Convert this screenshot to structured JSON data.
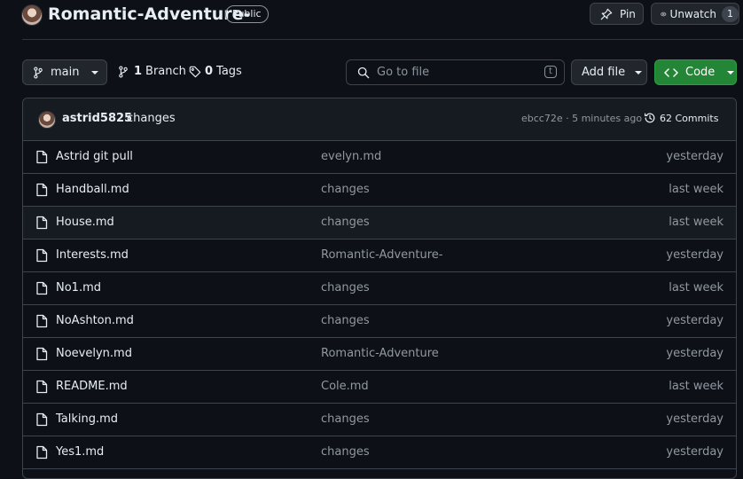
{
  "repo": {
    "name": "Romantic-Adventure-",
    "visibility": "Public"
  },
  "actions": {
    "pin_label": "Pin",
    "unwatch_label": "Unwatch",
    "watch_count": "1"
  },
  "toolbar": {
    "branch": "main",
    "branch_count": "1",
    "branch_label": "Branch",
    "tag_count": "0",
    "tag_label": "Tags",
    "search_placeholder": "Go to file",
    "search_shortcut": "t",
    "add_file_label": "Add file",
    "code_label": "Code"
  },
  "latest_commit": {
    "author": "astrid5825",
    "message": "changes",
    "hash_time": "ebcc72e · 5 minutes ago",
    "commits_label": "62 Commits"
  },
  "files": [
    {
      "name": "Astrid git pull",
      "message": "evelyn.md",
      "time": "yesterday"
    },
    {
      "name": "Handball.md",
      "message": "changes",
      "time": "last week"
    },
    {
      "name": "House.md",
      "message": "changes",
      "time": "last week"
    },
    {
      "name": "Interests.md",
      "message": "Romantic-Adventure-",
      "time": "yesterday"
    },
    {
      "name": "No1.md",
      "message": "changes",
      "time": "last week"
    },
    {
      "name": "NoAshton.md",
      "message": "changes",
      "time": "yesterday"
    },
    {
      "name": "Noevelyn.md",
      "message": "Romantic-Adventure",
      "time": "yesterday"
    },
    {
      "name": "README.md",
      "message": "Cole.md",
      "time": "last week"
    },
    {
      "name": "Talking.md",
      "message": "changes",
      "time": "yesterday"
    },
    {
      "name": "Yes1.md",
      "message": "changes",
      "time": "yesterday"
    }
  ],
  "colors": {
    "background": "#0d1117",
    "border": "#3d444d",
    "code_button": "#238636",
    "muted_text": "#9198a1"
  }
}
